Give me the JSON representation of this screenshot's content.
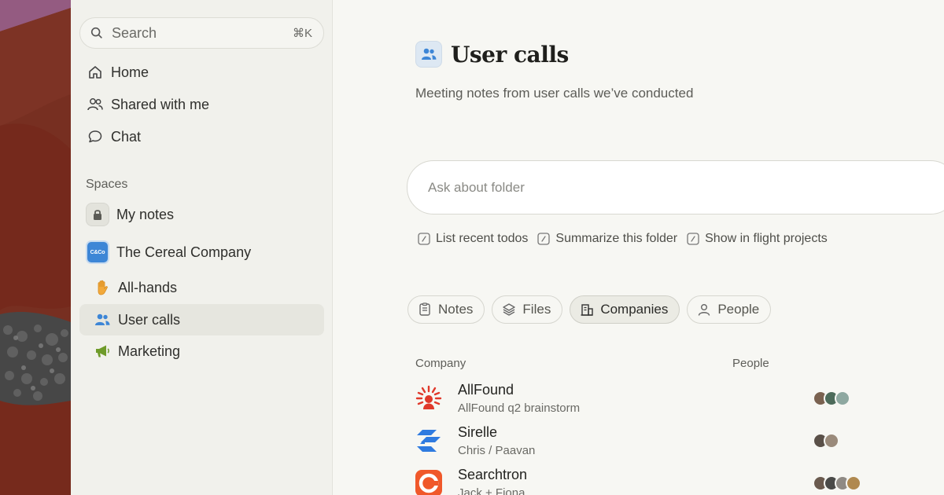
{
  "sidebar": {
    "search": {
      "placeholder": "Search",
      "shortcut": "⌘K"
    },
    "nav": [
      {
        "label": "Home",
        "icon": "home-icon"
      },
      {
        "label": "Shared with me",
        "icon": "people-icon"
      },
      {
        "label": "Chat",
        "icon": "chat-bubble-icon"
      }
    ],
    "spaces_label": "Spaces",
    "spaces": [
      {
        "label": "My notes",
        "icon": "lock-icon"
      },
      {
        "label": "The Cereal Company",
        "icon": "company-logo-icon",
        "logo_text": "C&Co"
      }
    ],
    "folders": [
      {
        "label": "All-hands",
        "icon": "raised-hand-icon"
      },
      {
        "label": "User calls",
        "icon": "people-icon",
        "active": true
      },
      {
        "label": "Marketing",
        "icon": "megaphone-icon"
      }
    ]
  },
  "main": {
    "title": "User calls",
    "subtitle": "Meeting notes from user calls we’ve conducted",
    "ask_placeholder": "Ask about folder",
    "suggestions": [
      "List recent todos",
      "Summarize this folder",
      "Show in flight projects"
    ],
    "tabs": [
      {
        "label": "Notes",
        "icon": "notes-icon"
      },
      {
        "label": "Files",
        "icon": "layers-icon"
      },
      {
        "label": "Companies",
        "icon": "building-icon",
        "active": true
      },
      {
        "label": "People",
        "icon": "person-icon"
      }
    ],
    "table": {
      "columns": [
        "Company",
        "People"
      ],
      "rows": [
        {
          "name": "AllFound",
          "sub": "AllFound q2 brainstorm",
          "logo": "allfound-logo",
          "people": 3
        },
        {
          "name": "Sirelle",
          "sub": "Chris / Paavan",
          "logo": "sirelle-logo",
          "people": 2
        },
        {
          "name": "Searchtron",
          "sub": "Jack + Fiona",
          "logo": "searchtron-logo",
          "people": 4
        }
      ]
    }
  },
  "colors": {
    "accent_blue": "#3d86d6",
    "allfound_red": "#e0392b",
    "sirelle_blue": "#2f7be0",
    "searchtron_orange": "#f0582a",
    "sidebar_bg": "#f1f1ec",
    "main_bg": "#f7f7f3"
  }
}
